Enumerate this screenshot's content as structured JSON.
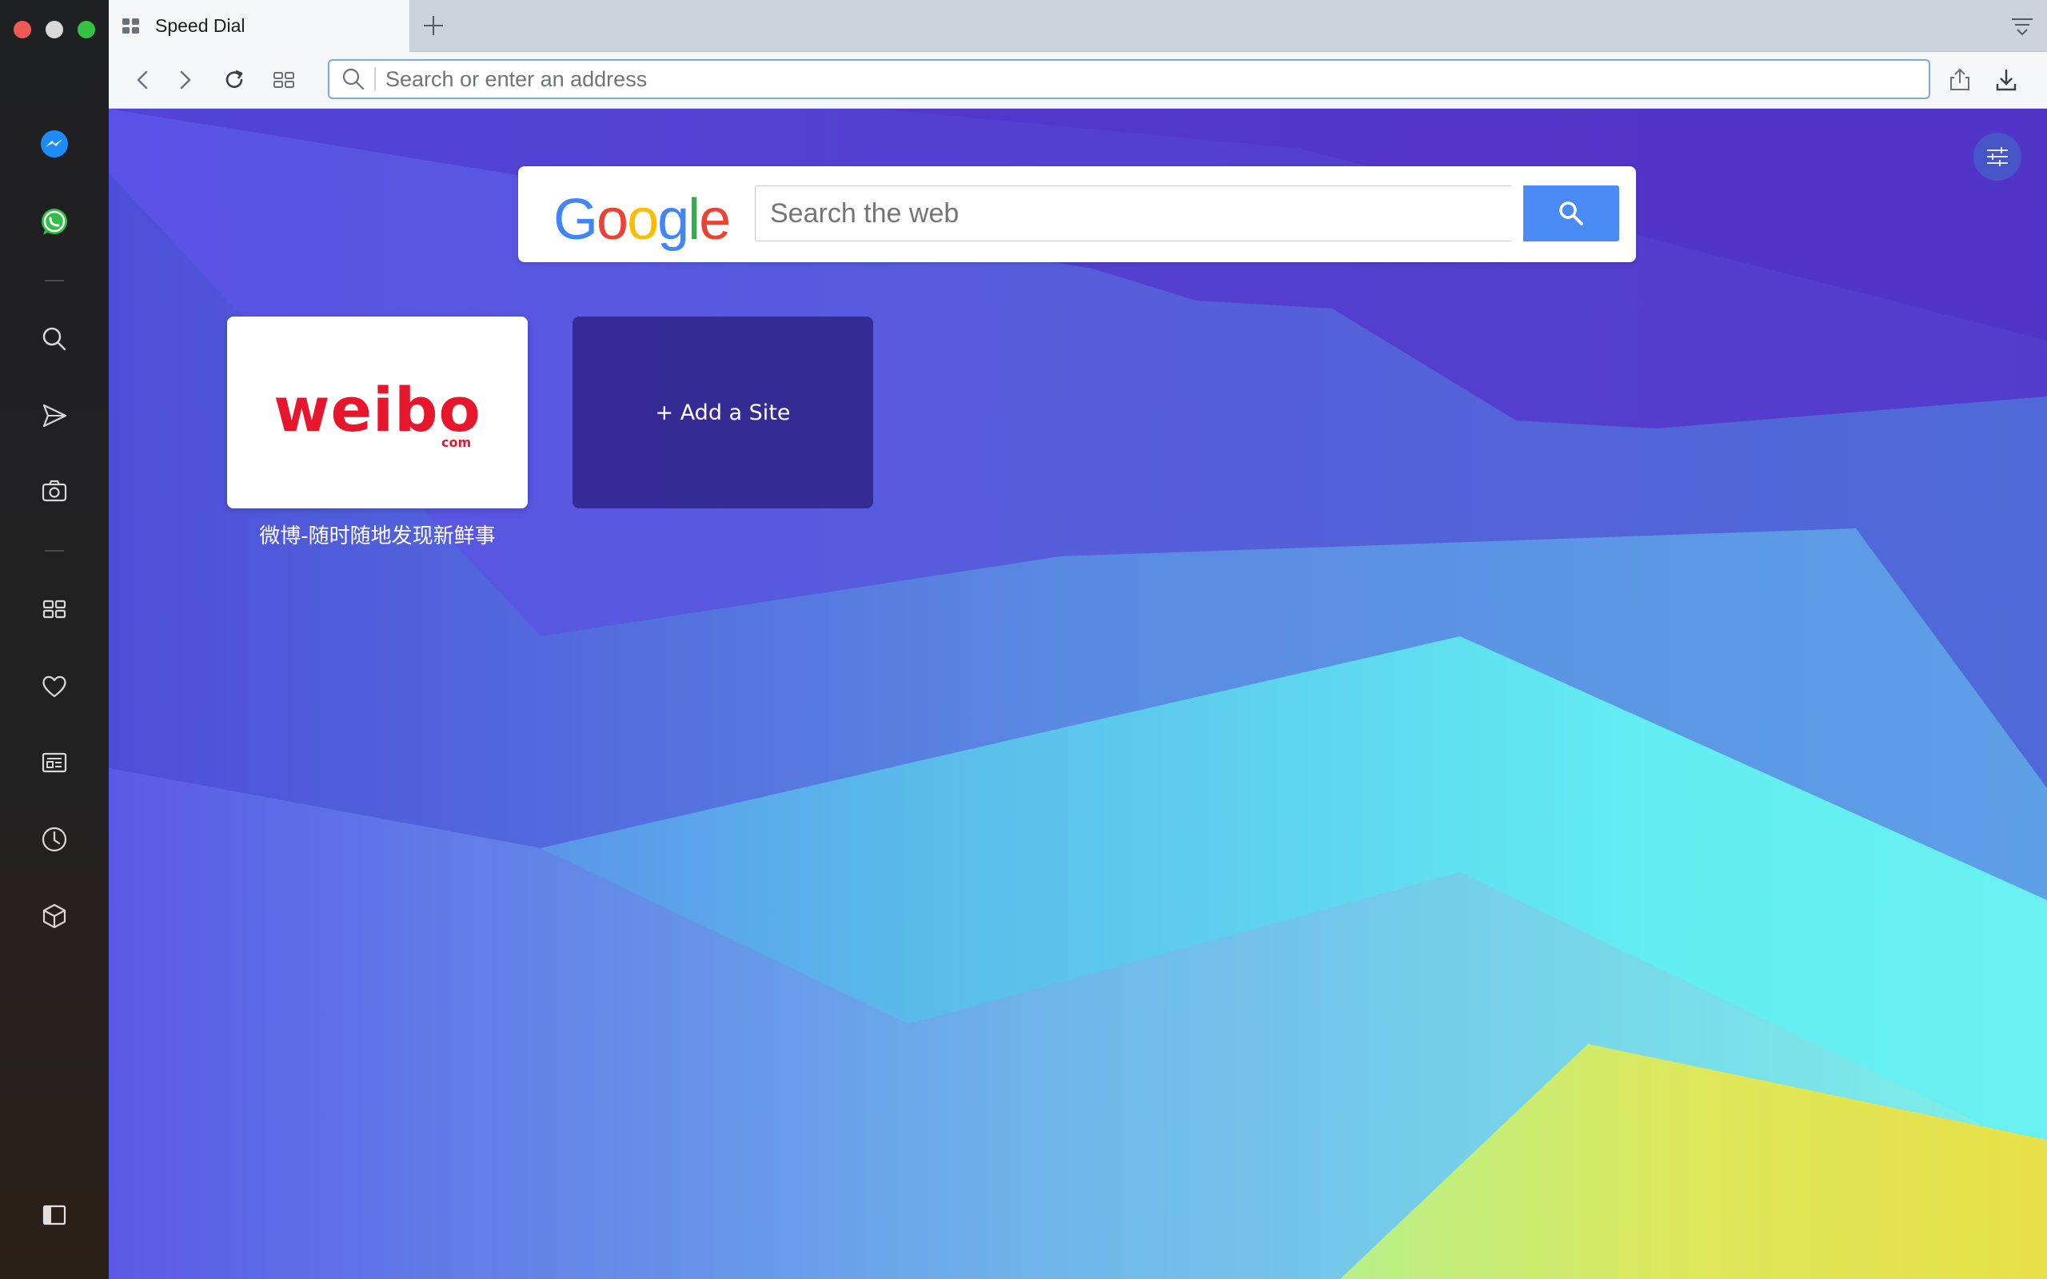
{
  "tab": {
    "title": "Speed Dial",
    "icon": "speed-dial-icon"
  },
  "address_bar": {
    "placeholder": "Search or enter an address"
  },
  "sidebar": {
    "items": [
      {
        "name": "messenger-icon"
      },
      {
        "name": "whatsapp-icon"
      },
      {
        "name": "search-icon"
      },
      {
        "name": "send-icon"
      },
      {
        "name": "camera-icon"
      },
      {
        "name": "speed-dial-icon"
      },
      {
        "name": "heart-icon"
      },
      {
        "name": "news-icon"
      },
      {
        "name": "history-icon"
      },
      {
        "name": "extensions-icon"
      },
      {
        "name": "sidebar-toggle-icon"
      }
    ]
  },
  "search_box": {
    "logo": [
      "G",
      "o",
      "o",
      "g",
      "l",
      "e"
    ],
    "logo_colors": [
      "#4285F4",
      "#EA4335",
      "#FBBC05",
      "#4285F4",
      "#34A853",
      "#EA4335"
    ],
    "placeholder": "Search the web"
  },
  "speed_dial": {
    "sites": [
      {
        "logo_text": "weibo",
        "logo_sub": "com",
        "caption": "微博-随时随地发现新鲜事"
      }
    ],
    "add_label": "+ Add a Site"
  },
  "colors": {
    "accent": "#4a8af4",
    "weibo_red": "#e6162d"
  }
}
